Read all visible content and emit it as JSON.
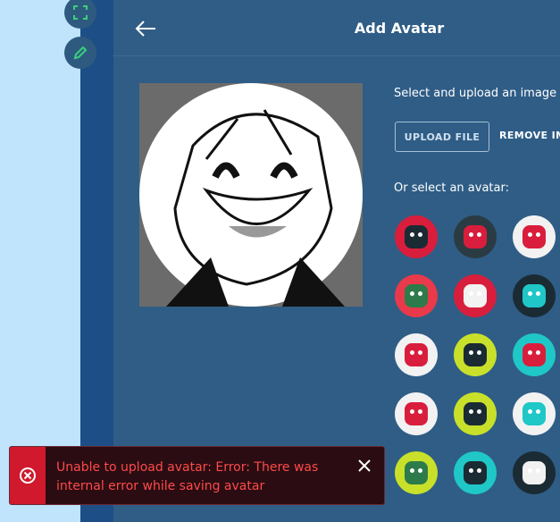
{
  "header": {
    "title": "Add Avatar"
  },
  "upload": {
    "prompt": "Select and upload an image",
    "upload_label": "UPLOAD FILE",
    "remove_label": "REMOVE IM"
  },
  "avatars_label": "Or select an avatar:",
  "avatars": [
    {
      "bg": "#d81e3c",
      "face": "#1b2b34"
    },
    {
      "bg": "#2b3b43",
      "face": "#d81e3c"
    },
    {
      "bg": "#f2f2f2",
      "face": "#d81e3c"
    },
    {
      "bg": "#e83a4a",
      "face": "#2d7b4a"
    },
    {
      "bg": "#d81e3c",
      "face": "#f2f2f2"
    },
    {
      "bg": "#1b2b34",
      "face": "#1fc7c7"
    },
    {
      "bg": "#f2f2f2",
      "face": "#d81e3c"
    },
    {
      "bg": "#c8e02a",
      "face": "#1b2b34"
    },
    {
      "bg": "#1fc7c7",
      "face": "#d81e3c"
    },
    {
      "bg": "#f2f2f2",
      "face": "#d81e3c"
    },
    {
      "bg": "#c8e02a",
      "face": "#1b2b34"
    },
    {
      "bg": "#f2f2f2",
      "face": "#1fc7c7"
    },
    {
      "bg": "#c8e02a",
      "face": "#2d7b4a"
    },
    {
      "bg": "#1fc7c7",
      "face": "#1b2b34"
    },
    {
      "bg": "#1b2b34",
      "face": "#f2f2f2"
    }
  ],
  "toast": {
    "message": "Unable to upload avatar: Error: There was internal error while saving avatar"
  },
  "colors": {
    "panel": "#2f5d86",
    "accent_error": "#d0192d"
  }
}
